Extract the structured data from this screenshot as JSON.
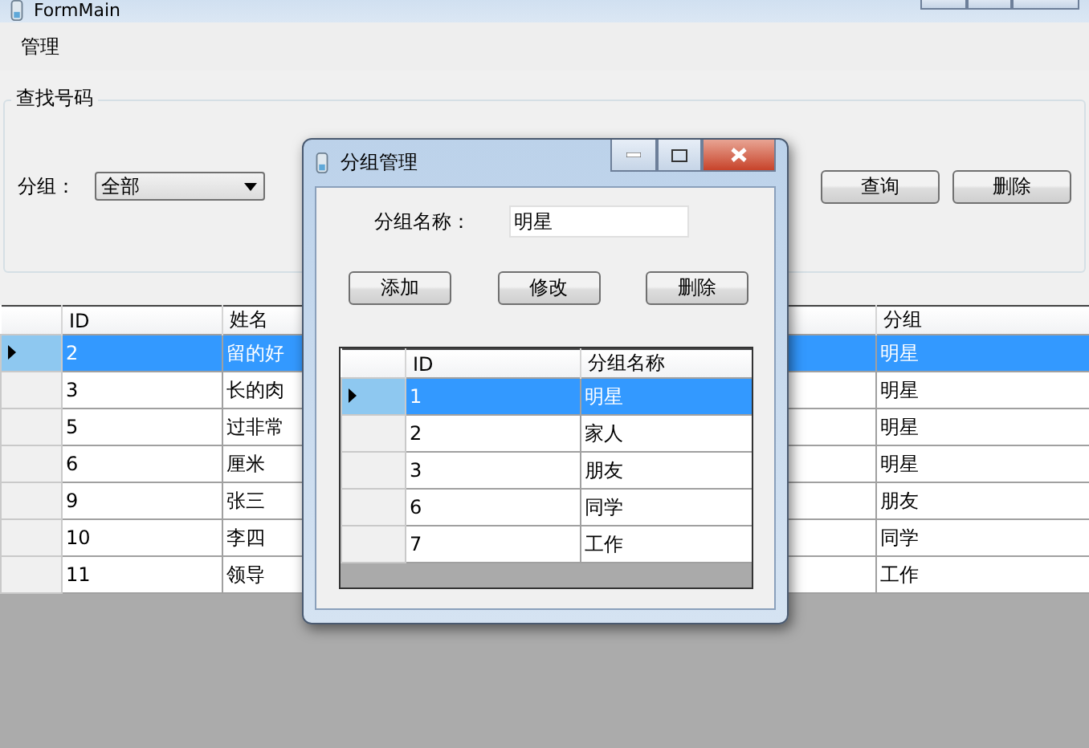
{
  "window": {
    "title": "FormMain"
  },
  "menu": [
    "管理"
  ],
  "search_group": {
    "title": "查找号码",
    "group_label": "分组：",
    "group_value": "全部",
    "buttons": [
      "查询",
      "删除"
    ]
  },
  "table": {
    "columns": [
      "ID",
      "姓名",
      "分组"
    ],
    "rows": [
      {
        "cells": [
          "2",
          "留的好",
          "明星"
        ],
        "selected": true
      },
      {
        "cells": [
          "3",
          "长的肉",
          "明星"
        ],
        "selected": false
      },
      {
        "cells": [
          "5",
          "过非常",
          "明星"
        ],
        "selected": false
      },
      {
        "cells": [
          "6",
          "厘米",
          "明星"
        ],
        "selected": false
      },
      {
        "cells": [
          "9",
          "张三",
          "朋友"
        ],
        "selected": false
      },
      {
        "cells": [
          "10",
          "李四",
          "同学"
        ],
        "selected": false
      },
      {
        "cells": [
          "11",
          "领导",
          "工作"
        ],
        "selected": false
      }
    ]
  },
  "dialog": {
    "title": "分组管理",
    "name_label": "分组名称：",
    "name_value": "明星",
    "buttons": [
      "添加",
      "修改",
      "删除"
    ],
    "table": {
      "columns": [
        "ID",
        "分组名称"
      ],
      "rows": [
        {
          "cells": [
            "1",
            "明星"
          ],
          "selected": true
        },
        {
          "cells": [
            "2",
            "家人"
          ],
          "selected": false
        },
        {
          "cells": [
            "3",
            "朋友"
          ],
          "selected": false
        },
        {
          "cells": [
            "6",
            "同学"
          ],
          "selected": false
        },
        {
          "cells": [
            "7",
            "工作"
          ],
          "selected": false
        }
      ]
    }
  }
}
